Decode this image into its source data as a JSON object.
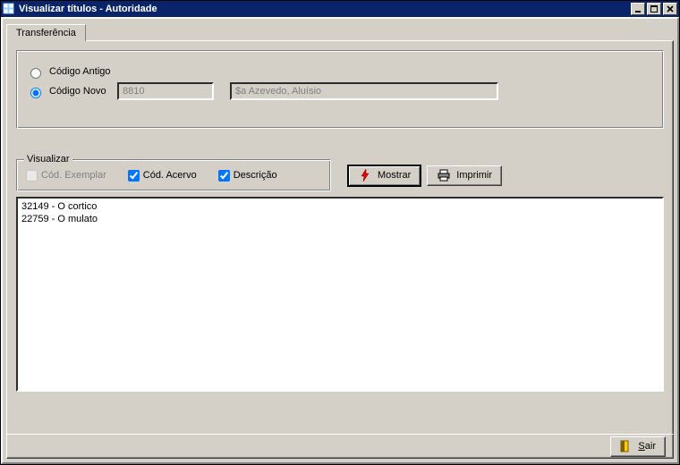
{
  "window": {
    "title": "Visualizar títulos - Autoridade"
  },
  "tabs": {
    "main": "Transferência"
  },
  "transfer": {
    "radio_old": "Código Antigo",
    "radio_new": "Código Novo",
    "selected": "new",
    "code_value": "8810",
    "name_value": "$a Azevedo, Aluísio"
  },
  "viz": {
    "legend": "Visualizar",
    "opt_exemplar": "Cód. Exemplar",
    "opt_acervo": "Cód. Acervo",
    "opt_descricao": "Descrição",
    "exemplar_checked": false,
    "acervo_checked": true,
    "descricao_checked": true
  },
  "buttons": {
    "mostrar": "Mostrar",
    "imprimir": "Imprimir",
    "sair": "Sair"
  },
  "results": [
    "32149 - O cortico",
    "22759 - O mulato"
  ]
}
